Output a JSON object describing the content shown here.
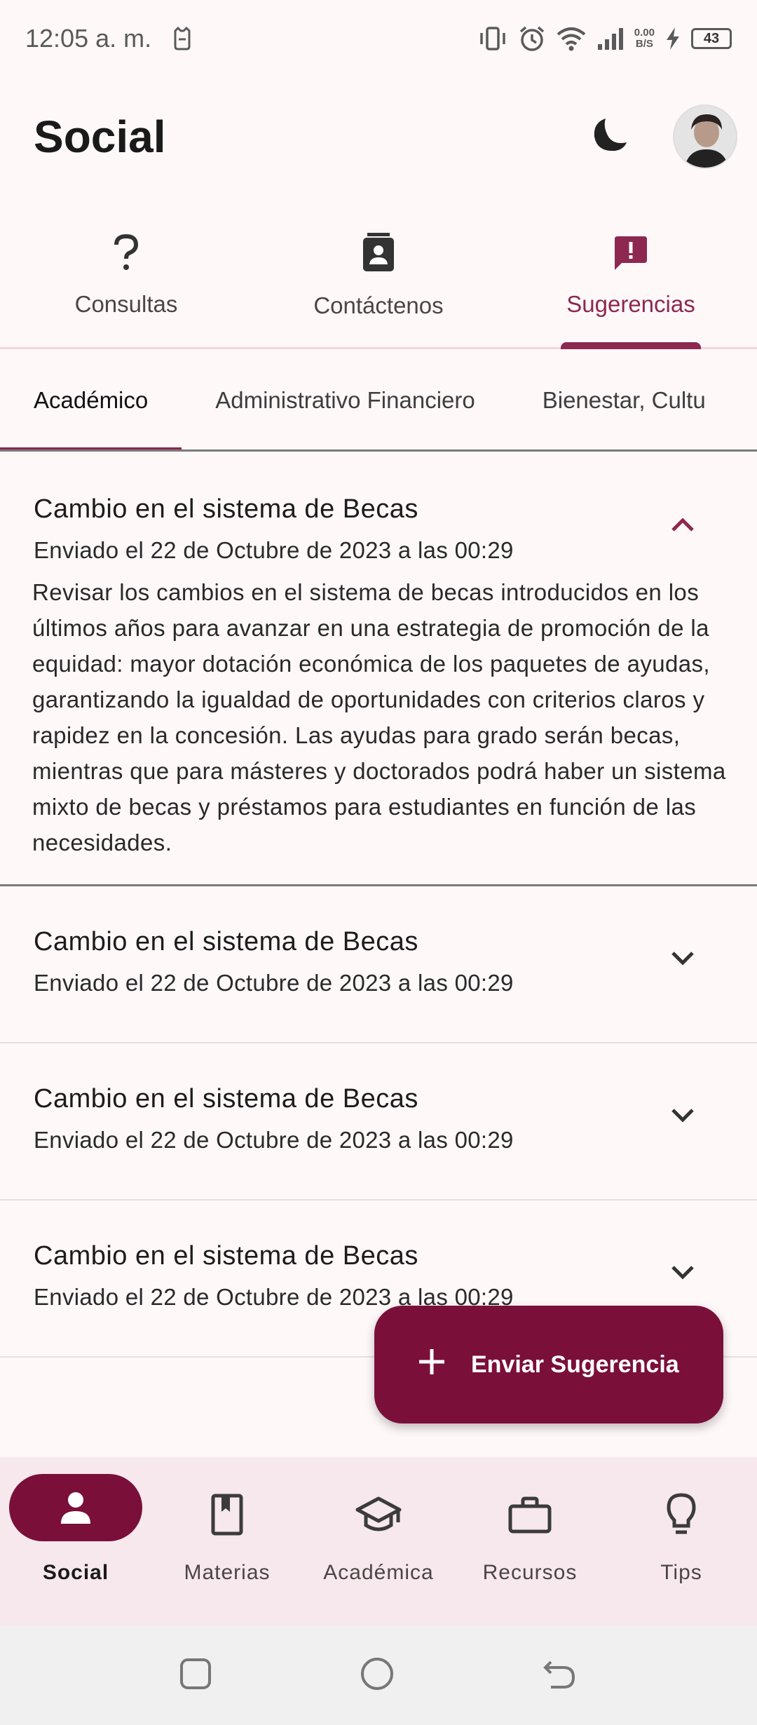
{
  "status_bar": {
    "time": "12:05 a. m.",
    "speed_value": "0.00",
    "speed_unit": "B/S",
    "battery": "43"
  },
  "app_bar": {
    "title": "Social"
  },
  "main_tabs": [
    {
      "label": "Consultas",
      "icon": "question-icon",
      "active": false
    },
    {
      "label": "Contáctenos",
      "icon": "contact-card-icon",
      "active": false
    },
    {
      "label": "Sugerencias",
      "icon": "feedback-icon",
      "active": true
    }
  ],
  "sub_tabs": [
    {
      "label": "Académico",
      "active": true
    },
    {
      "label": "Administrativo Financiero",
      "active": false
    },
    {
      "label": "Bienestar, Cultu",
      "active": false
    }
  ],
  "suggestions": [
    {
      "title": "Cambio en el sistema de Becas",
      "sent": "Enviado el 22 de Octubre de 2023 a las 00:29",
      "expanded": true,
      "body": "Revisar los cambios en el sistema de becas introducidos en los últimos años para avanzar en una estrategia de promoción de la equidad: mayor dotación económica de los paquetes de ayudas, garantizando la igualdad de oportunidades con criterios claros y rapidez en la concesión. Las ayudas para grado serán becas, mientras que para másteres y doctorados podrá haber un sistema mixto de becas y préstamos para estudiantes en función de las necesidades."
    },
    {
      "title": "Cambio en el sistema de Becas",
      "sent": "Enviado el 22 de Octubre de 2023 a las 00:29",
      "expanded": false
    },
    {
      "title": "Cambio en el sistema de Becas",
      "sent": "Enviado el 22 de Octubre de 2023 a las 00:29",
      "expanded": false
    },
    {
      "title": "Cambio en el sistema de Becas",
      "sent": "Enviado el 22 de Octubre de 2023 a las 00:29",
      "expanded": false
    }
  ],
  "fab": {
    "label": "Enviar Sugerencia"
  },
  "bottom_nav": [
    {
      "label": "Social",
      "icon": "person-icon",
      "active": true
    },
    {
      "label": "Materias",
      "icon": "book-icon",
      "active": false
    },
    {
      "label": "Académica",
      "icon": "graduation-cap-icon",
      "active": false
    },
    {
      "label": "Recursos",
      "icon": "briefcase-icon",
      "active": false
    },
    {
      "label": "Tips",
      "icon": "lightbulb-icon",
      "active": false
    }
  ],
  "colors": {
    "accent": "#8d2850",
    "fab": "#7a0f3a",
    "nav_bg": "#f6e8ec",
    "background": "#fff8f9"
  }
}
